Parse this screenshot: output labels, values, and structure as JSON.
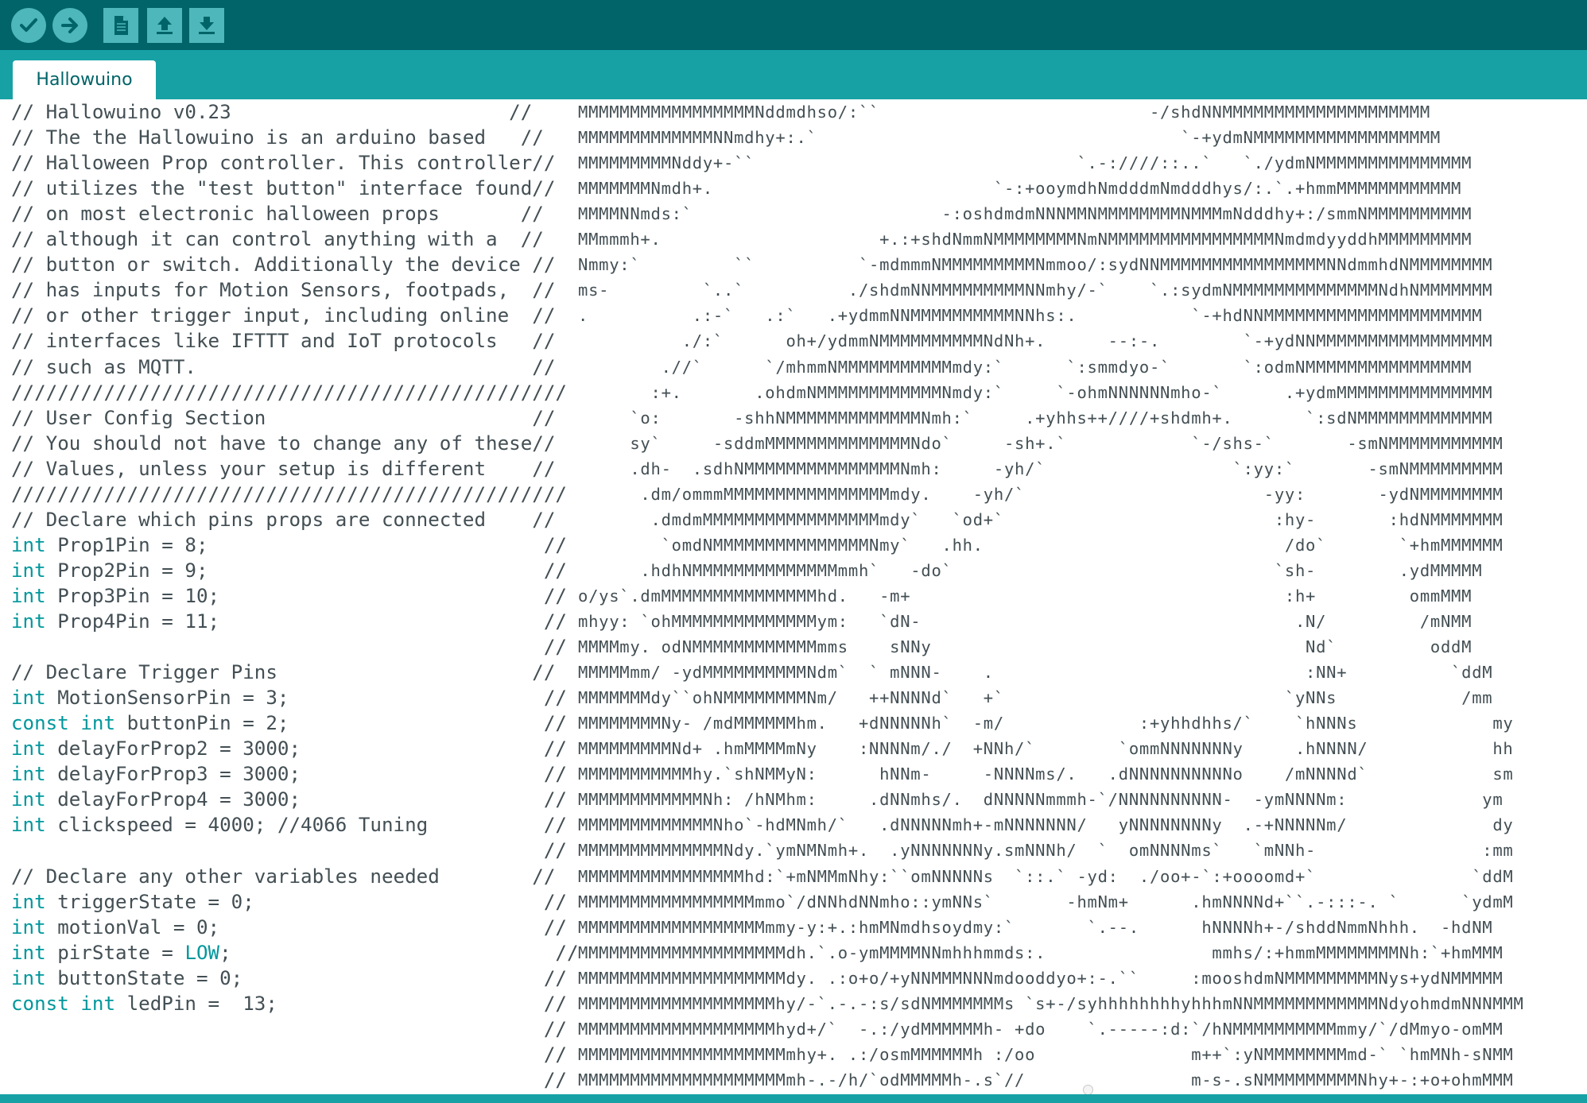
{
  "toolbar": {
    "buttons": [
      {
        "name": "verify",
        "icon": "checkmark-icon"
      },
      {
        "name": "upload",
        "icon": "arrow-right-icon"
      },
      {
        "name": "new",
        "icon": "document-icon"
      },
      {
        "name": "open",
        "icon": "arrow-up-icon"
      },
      {
        "name": "save",
        "icon": "arrow-down-icon"
      }
    ]
  },
  "tab": {
    "label": "Hallowuino"
  },
  "colors": {
    "toolbar_bg": "#006468",
    "tabstrip_bg": "#17a1a5",
    "button_bg": "#4db7bb",
    "keyword": "#00979c",
    "text": "#434f54"
  },
  "code": [
    {
      "parts": [
        {
          "t": "// Hallowuino v0.23                        //",
          "c": "cm"
        }
      ]
    },
    {
      "parts": [
        {
          "t": "// The the Hallowuino is an arduino based   //",
          "c": "cm"
        }
      ]
    },
    {
      "parts": [
        {
          "t": "// Halloween Prop controller. This controller//",
          "c": "cm"
        }
      ]
    },
    {
      "parts": [
        {
          "t": "// utilizes the \"test button\" interface found//",
          "c": "cm"
        }
      ]
    },
    {
      "parts": [
        {
          "t": "// on most electronic halloween props       //",
          "c": "cm"
        }
      ]
    },
    {
      "parts": [
        {
          "t": "// although it can control anything with a  //",
          "c": "cm"
        }
      ]
    },
    {
      "parts": [
        {
          "t": "// button or switch. Additionally the device //",
          "c": "cm"
        }
      ]
    },
    {
      "parts": [
        {
          "t": "// has inputs for Motion Sensors, footpads,  //",
          "c": "cm"
        }
      ]
    },
    {
      "parts": [
        {
          "t": "// or other trigger input, including online  //",
          "c": "cm"
        }
      ]
    },
    {
      "parts": [
        {
          "t": "// interfaces like IFTTT and IoT protocols   //",
          "c": "cm"
        }
      ]
    },
    {
      "parts": [
        {
          "t": "// such as MQTT.                             //",
          "c": "cm"
        }
      ]
    },
    {
      "parts": [
        {
          "t": "////////////////////////////////////////////////",
          "c": "cm"
        }
      ]
    },
    {
      "parts": [
        {
          "t": "// User Config Section                       //",
          "c": "cm"
        }
      ]
    },
    {
      "parts": [
        {
          "t": "// You should not have to change any of these//",
          "c": "cm"
        }
      ]
    },
    {
      "parts": [
        {
          "t": "// Values, unless your setup is different    //",
          "c": "cm"
        }
      ]
    },
    {
      "parts": [
        {
          "t": "////////////////////////////////////////////////",
          "c": "cm"
        }
      ]
    },
    {
      "parts": [
        {
          "t": "// Declare which pins props are connected    //",
          "c": "cm"
        }
      ]
    },
    {
      "parts": [
        {
          "t": "int",
          "c": "kw"
        },
        {
          "t": " Prop1Pin = 8;                             //",
          "c": "cm"
        }
      ]
    },
    {
      "parts": [
        {
          "t": "int",
          "c": "kw"
        },
        {
          "t": " Prop2Pin = 9;                             //",
          "c": "cm"
        }
      ]
    },
    {
      "parts": [
        {
          "t": "int",
          "c": "kw"
        },
        {
          "t": " Prop3Pin = 10;                            //",
          "c": "cm"
        }
      ]
    },
    {
      "parts": [
        {
          "t": "int",
          "c": "kw"
        },
        {
          "t": " Prop4Pin = 11;                            //",
          "c": "cm"
        }
      ]
    },
    {
      "parts": [
        {
          "t": "                                              //",
          "c": "cm"
        }
      ]
    },
    {
      "parts": [
        {
          "t": "// Declare Trigger Pins                      //",
          "c": "cm"
        }
      ]
    },
    {
      "parts": [
        {
          "t": "int",
          "c": "kw"
        },
        {
          "t": " MotionSensorPin = 3;                      //",
          "c": "cm"
        }
      ]
    },
    {
      "parts": [
        {
          "t": "const",
          "c": "kw"
        },
        {
          "t": " ",
          "c": "cm"
        },
        {
          "t": "int",
          "c": "kw"
        },
        {
          "t": " buttonPin = 2;                      //",
          "c": "cm"
        }
      ]
    },
    {
      "parts": [
        {
          "t": "int",
          "c": "kw"
        },
        {
          "t": " delayForProp2 = 3000;                     //",
          "c": "cm"
        }
      ]
    },
    {
      "parts": [
        {
          "t": "int",
          "c": "kw"
        },
        {
          "t": " delayForProp3 = 3000;                     //",
          "c": "cm"
        }
      ]
    },
    {
      "parts": [
        {
          "t": "int",
          "c": "kw"
        },
        {
          "t": " delayForProp4 = 3000;                     //",
          "c": "cm"
        }
      ]
    },
    {
      "parts": [
        {
          "t": "int",
          "c": "kw"
        },
        {
          "t": " clickspeed = 4000; //4066 Tuning          //",
          "c": "cm"
        }
      ]
    },
    {
      "parts": [
        {
          "t": "                                              //",
          "c": "cm"
        }
      ]
    },
    {
      "parts": [
        {
          "t": "// Declare any other variables needed        //",
          "c": "cm"
        }
      ]
    },
    {
      "parts": [
        {
          "t": "int",
          "c": "kw"
        },
        {
          "t": " triggerState = 0;                         //",
          "c": "cm"
        }
      ]
    },
    {
      "parts": [
        {
          "t": "int",
          "c": "kw"
        },
        {
          "t": " motionVal = 0;                            //",
          "c": "cm"
        }
      ]
    },
    {
      "parts": [
        {
          "t": "int",
          "c": "kw"
        },
        {
          "t": " pirState = ",
          "c": "cm"
        },
        {
          "t": "LOW",
          "c": "lit"
        },
        {
          "t": ";                            //",
          "c": "cm"
        }
      ]
    },
    {
      "parts": [
        {
          "t": "int",
          "c": "kw"
        },
        {
          "t": " buttonState = 0;                          //",
          "c": "cm"
        }
      ]
    },
    {
      "parts": [
        {
          "t": "const",
          "c": "kw"
        },
        {
          "t": " ",
          "c": "cm"
        },
        {
          "t": "int",
          "c": "kw"
        },
        {
          "t": " ledPin =  13;                       //",
          "c": "cm"
        }
      ]
    },
    {
      "parts": [
        {
          "t": "                                              //",
          "c": "cm"
        }
      ]
    },
    {
      "parts": [
        {
          "t": "                                              //",
          "c": "cm"
        }
      ]
    },
    {
      "parts": [
        {
          "t": "                                              //",
          "c": "cm"
        }
      ]
    }
  ],
  "art": [
    "MMMMMMMMMMMMMMMMMNddmdhso/:``                          -/shdNNMMMMMMMMMMMMMMMMMMMM",
    "MMMMMMMMMMMMMNNmdhy+:.`                                   `-+ydmNMMMMMMMMMMMMMMMMMM",
    "MMMMMMMMMNddy+-``                               `.-:////::..`   `./ydmNMMMMMMMMMMMMMMM",
    "MMMMMMMNmdh+.                           `-:+ooymdhNmdddmNmdddhys/:.`.+hmmMMMMMMMMMMMM",
    "MMMMNNmds:`                        -:oshdmdmNNNMMNMMMMMMMMNMMMmNdddhy+:/smmNMMMMMMMMMM",
    "MMmmmh+.                     +.:+shdNmmNMMMMMMMMNmNMMMMMMMMMMMMMMMMNmdmdyyddhMMMMMMMMM",
    "Nmmy:`         ``          `-mdmmmNMMMMMMMMMNmmoo/:sydNNMMMMMMMMMMMMMMMMNNdmmhdNMMMMMMMM",
    "ms-         `..`          ./shdmNNMMMMMMMMMNNmhy/-`    `.:sydmNMMMMMMMMMMMMMMNdhNMMMMMMM",
    ".          .:-`   .:`   .+ydmmNNMMMMMMMMMMNNhs:.           `-+hdNNMMMMMMMMMMMMMMMMMMMMM",
    "          ./:`      oh+/ydmmNMMMMMMMMMMNdNh+.      --:-.        `-+ydNNMMMMMMMMMMMMMMMMM",
    "        .//`      `/mhmmNMMMMMMMMMMMmdy:`      `:smmdyo-`       `:odmNMMMMMMMMMMMMMMMM",
    "       :+.       .ohdmNMMMMMMMMMMMMNmdy:`     `-ohmNNNNNNmho-`      .+ydmMMMMMMMMMMMMMMM",
    "     `o:       -shhNMMMMMMMMMMMMMNmh:`     .+yhhs++////+shdmh+.       `:sdNMMMMMMMMMMMMM",
    "     sy`     -sddmMMMMMMMMMMMMMMNdo`     -sh+.`            `-/shs-`       -smNMMMMMMMMMMM",
    "     .dh-  .sdhNMMMMMMMMMMMMMMMNmh:     -yh/`                  `:yy:`       -smNMMMMMMMMM",
    "      .dm/ommmMMMMMMMMMMMMMMMMmdy.    -yh/`                       -yy:       -ydNMMMMMMMM",
    "       .dmdmMMMMMMMMMMMMMMMMMmdy`   `od+`                          :hy-       :hdNMMMMMMM",
    "        `omdNMMMMMMMMMMMMMMMNmy`   .hh.                             /do`       `+hmMMMMMM",
    "      .hdhNMMMMMMMMMMMMMMmmh`   -do`                               `sh-        .ydMMMMM",
    "o/ys`.dmMMMMMMMMMMMMMMMhd.   -m+                                    :h+         ommMMM",
    "mhyy: `ohMMMMMMMMMMMMMMym:   `dN-                                    .N/         /mNMM",
    "MMMMmy. odNMMMMMMMMMMMMmms    sNNy                                    Nd`         oddM",
    "MMMMMmm/ -ydMMMMMMMMMMNdm`  ` mNNN-    .                              :NN+          `ddM",
    "MMMMMMMdy``ohNMMMMMMMMNm/   ++NNNNd`   +`                           `yNNs            /mm",
    "MMMMMMMMNy- /mdMMMMMMhm.   +dNNNNNh`  -m/             :+yhhdhhs/`    `hNNNs             my",
    "MMMMMMMMMNd+ .hmMMMMmNy    :NNNNm/./  +NNh/`        `ommNNNNNNNy     .hNNNN/            hh",
    "MMMMMMMMMMMhy.`shNMMyN:      hNNm-     -NNNNms/.   .dNNNNNNNNNNo    /mNNNNd`            sm",
    "MMMMMMMMMMMMNh: /hNMhm:     .dNNmhs/.  dNNNNNmmmh-`/NNNNNNNNNN-  -ymNNNNm:             ym",
    "MMMMMMMMMMMMMNho`-hdMNmh/`   .dNNNNNmh+-mNNNNNNN/   yNNNNNNNNy  .-+NNNNNm/              dy",
    "MMMMMMMMMMMMMMNdy.`ymNMNmh+.  .yNNNNNNNy.smNNNh/  `  omNNNNms`   `mNNh-                :mm",
    "MMMMMMMMMMMMMMMMhd:`+mNMMmNhy:``omNNNNNs  `::.` -yd:  ./oo+-`:+oooomd+`               `ddM",
    "MMMMMMMMMMMMMMMMMmmo`/dNNhdNNmho::ymNNs`       -hmNm+      .hmNNNNd+``.-:::-. `      `ydmM",
    "MMMMMMMMMMMMMMMMMMmmy-y:+.:hmMNmdhsoydmy:`       `.--.      hNNNNh+-/shddNmmNhhh.  -hdNM",
    "MMMMMMMMMMMMMMMMMMMMdh.`.o-ymMMMMNNmhhhmmds:.                mmhs/:+hmmMMMMMMMMNh:`+hmMMM",
    "MMMMMMMMMMMMMMMMMMMMdy. .:o+o/+yNNMMMNNNmdooddyo+:-.``     :mooshdmNMMMMMMMMMNys+ydNMMMMM",
    "MMMMMMMMMMMMMMMMMMMhy/-`.-.-:s/sdNMMMMMMMs `s+-/syhhhhhhhhyhhhmNNMMMMMMMMMMMMNdyohmdmNNNMMM",
    "MMMMMMMMMMMMMMMMMMMhyd+/`  -.:/ydMMMMMMh- +do    `.-----:d:`/hNMMMMMMMMMMmmy/`/dMmyo-omMM",
    "MMMMMMMMMMMMMMMMMMMMmhy+. .:/osmMMMMMMh :/oo               m++`:yNMMMMMMMMmd-` `hmMNh-sNMM",
    "MMMMMMMMMMMMMMMMMMMMmh-.-/h/`odMMMMMh-.s`//                m-s-.sNMMMMMMMMMNhy+-:+o+ohmMMM"
  ]
}
